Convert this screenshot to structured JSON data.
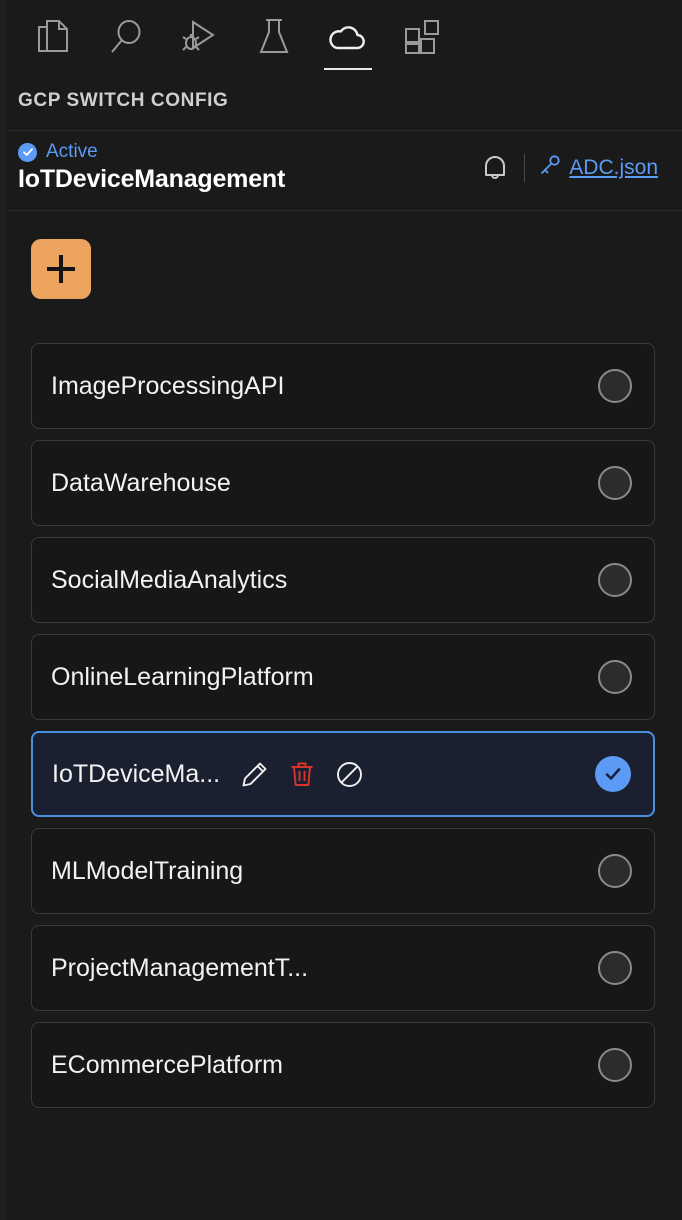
{
  "activity_bar": {
    "tabs": [
      {
        "name": "explorer",
        "icon": "files-icon",
        "active": false
      },
      {
        "name": "search",
        "icon": "search-icon",
        "active": false
      },
      {
        "name": "run-and-debug",
        "icon": "debug-play-icon",
        "active": false
      },
      {
        "name": "testing",
        "icon": "beaker-icon",
        "active": false
      },
      {
        "name": "cloud",
        "icon": "cloud-icon",
        "active": true
      },
      {
        "name": "extensions",
        "icon": "extensions-icon",
        "active": false
      }
    ]
  },
  "section": {
    "title": "GCP SWITCH CONFIG"
  },
  "active_header": {
    "status_label": "Active",
    "status_icon": "check-circle-icon",
    "project_name": "IoTDeviceManagement",
    "bell_icon": "bell-icon",
    "key_icon": "key-icon",
    "credentials_link": "ADC.json"
  },
  "toolbar": {
    "add_label": "+",
    "add_icon": "plus-icon"
  },
  "config_list": {
    "items": [
      {
        "label": "ImageProcessingAPI",
        "selected": false
      },
      {
        "label": "DataWarehouse",
        "selected": false
      },
      {
        "label": "SocialMediaAnalytics",
        "selected": false
      },
      {
        "label": "OnlineLearningPlatform",
        "selected": false
      },
      {
        "label": "IoTDeviceMa...",
        "selected": true
      },
      {
        "label": "MLModelTraining",
        "selected": false
      },
      {
        "label": "ProjectManagementT...",
        "selected": false
      },
      {
        "label": "ECommercePlatform",
        "selected": false
      }
    ],
    "selected_actions": [
      {
        "name": "edit",
        "icon": "pencil-icon"
      },
      {
        "name": "delete",
        "icon": "trash-icon"
      },
      {
        "name": "disable",
        "icon": "circle-slash-icon"
      }
    ]
  },
  "colors": {
    "background": "#1a1a1a",
    "accent_blue": "#5b9bf5",
    "add_button": "#eda45e",
    "danger_red": "#d9342b",
    "row_border": "#3a3a3a",
    "selected_border": "#4a90e2",
    "selected_bg": "#1b2030"
  }
}
